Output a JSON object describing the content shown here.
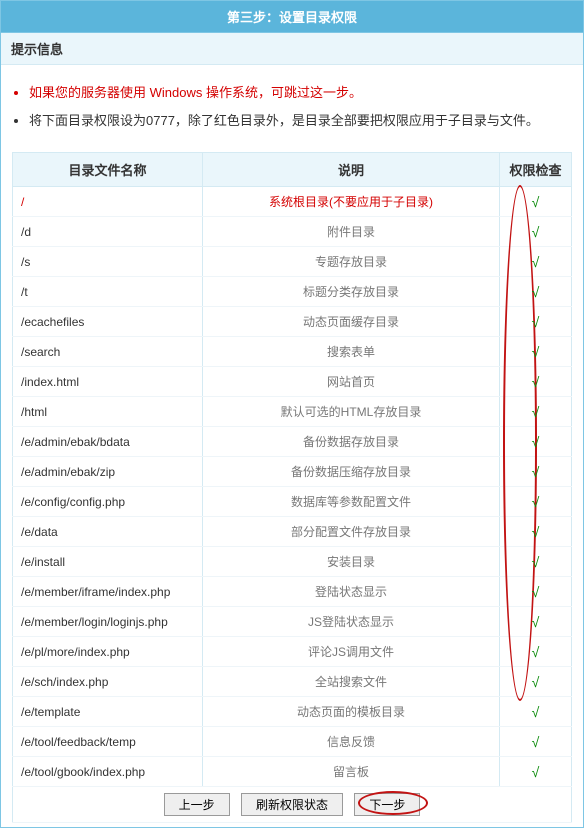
{
  "header": {
    "title": "第三步：设置目录权限",
    "subtitle": "提示信息"
  },
  "notes": {
    "line1": "如果您的服务器使用 Windows 操作系统，可跳过这一步。",
    "line2": "将下面目录权限设为0777，除了红色目录外，是目录全部要把权限应用于子目录与文件。"
  },
  "columns": {
    "path": "目录文件名称",
    "desc": "说明",
    "check": "权限检查"
  },
  "rows": [
    {
      "path": "/",
      "desc": "系统根目录(不要应用于子目录)",
      "check": "√",
      "red": true
    },
    {
      "path": "/d",
      "desc": "附件目录",
      "check": "√"
    },
    {
      "path": "/s",
      "desc": "专题存放目录",
      "check": "√"
    },
    {
      "path": "/t",
      "desc": "标题分类存放目录",
      "check": "√"
    },
    {
      "path": "/ecachefiles",
      "desc": "动态页面缓存目录",
      "check": "√"
    },
    {
      "path": "/search",
      "desc": "搜索表单",
      "check": "√"
    },
    {
      "path": "/index.html",
      "desc": "网站首页",
      "check": "√"
    },
    {
      "path": "/html",
      "desc": "默认可选的HTML存放目录",
      "check": "√"
    },
    {
      "path": "/e/admin/ebak/bdata",
      "desc": "备份数据存放目录",
      "check": "√"
    },
    {
      "path": "/e/admin/ebak/zip",
      "desc": "备份数据压缩存放目录",
      "check": "√"
    },
    {
      "path": "/e/config/config.php",
      "desc": "数据库等参数配置文件",
      "check": "√"
    },
    {
      "path": "/e/data",
      "desc": "部分配置文件存放目录",
      "check": "√"
    },
    {
      "path": "/e/install",
      "desc": "安装目录",
      "check": "√"
    },
    {
      "path": "/e/member/iframe/index.php",
      "desc": "登陆状态显示",
      "check": "√"
    },
    {
      "path": "/e/member/login/loginjs.php",
      "desc": "JS登陆状态显示",
      "check": "√"
    },
    {
      "path": "/e/pl/more/index.php",
      "desc": "评论JS调用文件",
      "check": "√"
    },
    {
      "path": "/e/sch/index.php",
      "desc": "全站搜索文件",
      "check": "√"
    },
    {
      "path": "/e/template",
      "desc": "动态页面的模板目录",
      "check": "√"
    },
    {
      "path": "/e/tool/feedback/temp",
      "desc": "信息反馈",
      "check": "√"
    },
    {
      "path": "/e/tool/gbook/index.php",
      "desc": "留言板",
      "check": "√"
    }
  ],
  "buttons": {
    "prev": "上一步",
    "refresh": "刷新权限状态",
    "next": "下一步"
  }
}
